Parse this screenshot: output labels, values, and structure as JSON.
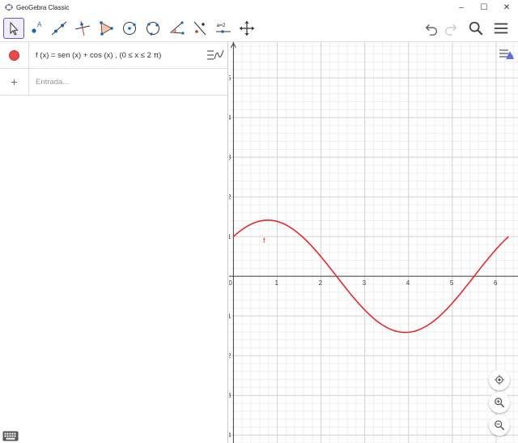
{
  "window": {
    "title": "GeoGebra Classic",
    "minimize": "–",
    "maximize": "☐",
    "close": "✕"
  },
  "toolbar": {
    "tools": [
      {
        "name": "move-tool",
        "active": true
      },
      {
        "name": "point-tool"
      },
      {
        "name": "line-tool"
      },
      {
        "name": "perpendicular-line-tool"
      },
      {
        "name": "polygon-tool"
      },
      {
        "name": "circle-center-point-tool"
      },
      {
        "name": "circle-three-points-tool"
      },
      {
        "name": "angle-tool"
      },
      {
        "name": "reflect-about-line-tool"
      },
      {
        "name": "slider-tool",
        "label": "a=2"
      },
      {
        "name": "move-graphics-view-tool"
      }
    ],
    "undo": "undo-icon",
    "redo": "redo-icon",
    "search": "search-icon",
    "menu": "hamburger-menu-icon"
  },
  "algebra": {
    "entries": [
      {
        "text": "f (x)  =  sen (x) + cos (x) ,      (0 ≤ x ≤ 2 π)",
        "color": "#e84a4a"
      }
    ],
    "input_placeholder": "Entrada..."
  },
  "graphics": {
    "x_ticks": [
      "0",
      "1",
      "2",
      "3",
      "4",
      "5",
      "6"
    ],
    "y_ticks": [
      "5",
      "4",
      "3",
      "2",
      "1",
      "−1",
      "−2",
      "−3",
      "−4"
    ],
    "curve_label": "f",
    "curve_color": "#e62a2a",
    "xlim": [
      -0.1,
      6.5
    ],
    "ylim": [
      -4.2,
      5.9
    ]
  },
  "chart_data": {
    "type": "line",
    "title": "",
    "xlabel": "",
    "ylabel": "",
    "series": [
      {
        "name": "f",
        "function": "sin(x)+cos(x)",
        "domain": [
          0,
          6.2832
        ]
      }
    ],
    "xlim": [
      -0.1,
      6.5
    ],
    "ylim": [
      -4.2,
      5.9
    ],
    "grid": true
  }
}
